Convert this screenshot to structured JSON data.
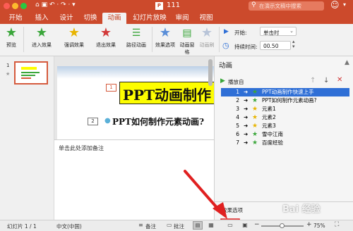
{
  "title": {
    "doc_name": "111",
    "search_placeholder": "在演示文稿中搜索"
  },
  "tabs": [
    "开始",
    "插入",
    "设计",
    "切换",
    "动画",
    "幻灯片放映",
    "审阅",
    "视图"
  ],
  "active_tab": "动画",
  "ribbon": {
    "buttons": [
      "预览",
      "进入效果",
      "强调效果",
      "退出效果",
      "路径动画",
      "效果选项",
      "动画窗格",
      "动画刷"
    ],
    "start_label": "开始:",
    "start_value": "单击时",
    "duration_label": "持续时间:",
    "duration_value": "00.50"
  },
  "slides_panel": {
    "slide_number": "1"
  },
  "slide": {
    "title_tag": "1",
    "title": "PPT动画制作",
    "bullet_tag": "2",
    "bullet": "PPT如何制作元素动画?"
  },
  "notes_placeholder": "单击此处添加备注",
  "animation_pane": {
    "title": "动画",
    "play_label": "播放自",
    "items": [
      {
        "num": "1",
        "text": "PPT动画制作快速上手",
        "selected": true,
        "star": "green"
      },
      {
        "num": "2",
        "text": "PPT如何制作元素动画?",
        "selected": false,
        "star": "green"
      },
      {
        "num": "3",
        "text": "元素1",
        "selected": false,
        "star": "yellow"
      },
      {
        "num": "4",
        "text": "元素2",
        "selected": false,
        "star": "yellow"
      },
      {
        "num": "5",
        "text": "元素3",
        "selected": false,
        "star": "yellow"
      },
      {
        "num": "6",
        "text": "雪中江南",
        "selected": false,
        "star": "green"
      },
      {
        "num": "7",
        "text": "百度经验",
        "selected": false,
        "star": "green"
      }
    ],
    "effect_options_label": "效果选项"
  },
  "statusbar": {
    "slide_info": "幻灯片 1 / 1",
    "language": "中文(中国)",
    "notes_label": "备注",
    "comments_label": "批注",
    "zoom": "75%"
  },
  "colors": {
    "titlebar": "#cc4a2c",
    "accent": "#c43e1c",
    "selection": "#2f6fd6",
    "slide_title_fill": "#fdfd00"
  },
  "watermark": "Bai 经验"
}
